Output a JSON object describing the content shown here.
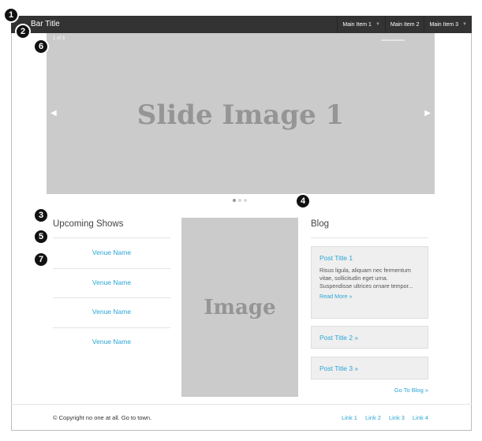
{
  "topbar": {
    "title": "Bar Title",
    "nav": [
      {
        "label": "Main Item 1",
        "caret": "▼"
      },
      {
        "label": "Main Item 2",
        "caret": ""
      },
      {
        "label": "Main Item 3",
        "caret": "▼"
      }
    ]
  },
  "slider": {
    "counter": "1 of 3",
    "slide_label": "Slide Image 1",
    "prev_icon": "◀",
    "next_icon": "▶",
    "dots": 3,
    "active_dot": 1
  },
  "shows": {
    "title": "Upcoming Shows",
    "venues": [
      "Venue Name",
      "Venue Name",
      "Venue Name",
      "Venue Name"
    ]
  },
  "image_placeholder": "Image",
  "blog": {
    "title": "Blog",
    "posts": [
      {
        "title": "Post Title 1",
        "excerpt": "Risus ligula, aliquam nec fermentum vitae, sollicitudin eget urna. Suspendisse ultrices ornare tempor...",
        "read_more": "Read More »"
      },
      {
        "title": "Post Title 2 »"
      },
      {
        "title": "Post Title 3 »"
      }
    ],
    "go_to_blog": "Go To Blog »"
  },
  "footer": {
    "copyright": "© Copyright no one at all. Go to town.",
    "links": [
      "Link 1",
      "Link 2",
      "Link 3",
      "Link 4"
    ]
  },
  "annotations": [
    "1",
    "2",
    "3",
    "4",
    "5",
    "6",
    "7"
  ],
  "colors": {
    "link": "#2aa6d6",
    "topbar": "#333333",
    "placeholder": "#cbcbcb"
  }
}
